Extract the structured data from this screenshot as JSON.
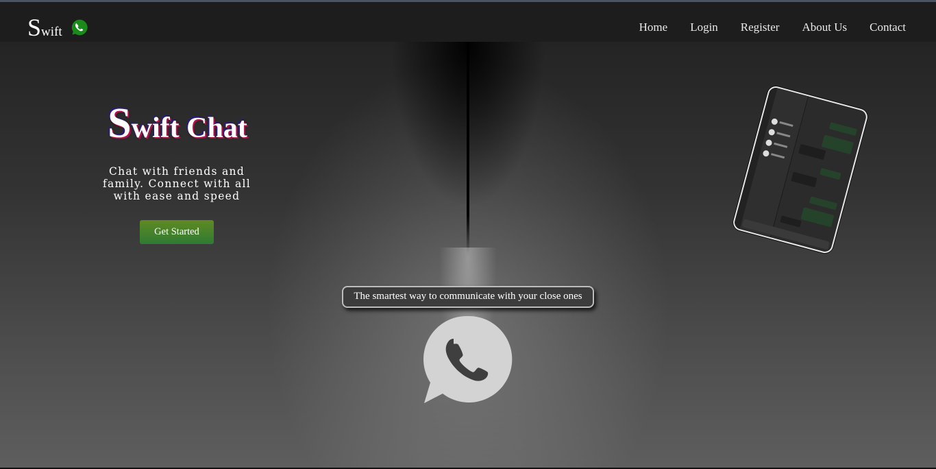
{
  "brand": {
    "logo_big": "S",
    "logo_small": "wift"
  },
  "nav": {
    "items": [
      {
        "label": "Home",
        "name": "nav-home"
      },
      {
        "label": "Login",
        "name": "nav-login"
      },
      {
        "label": "Register",
        "name": "nav-register"
      },
      {
        "label": "About Us",
        "name": "nav-about-us"
      },
      {
        "label": "Contact",
        "name": "nav-contact"
      }
    ]
  },
  "hero": {
    "title_big": "S",
    "title_rest": "wift Chat",
    "tagline": "Chat with friends and family. Connect with all with ease and speed",
    "cta_label": "Get Started",
    "pill_text": "The smartest way to communicate with your close ones"
  },
  "colors": {
    "navbar": "#1d1d1d",
    "cta_top": "#5f8a22",
    "cta_bottom": "#2f7a34",
    "whatsapp_green": "#1a8a1a",
    "icon_gray": "#d3d3d3"
  },
  "icons": {
    "logo_icon": "whatsapp-icon",
    "hero_icon": "whatsapp-icon",
    "preview": "phone-screenshot-image"
  }
}
